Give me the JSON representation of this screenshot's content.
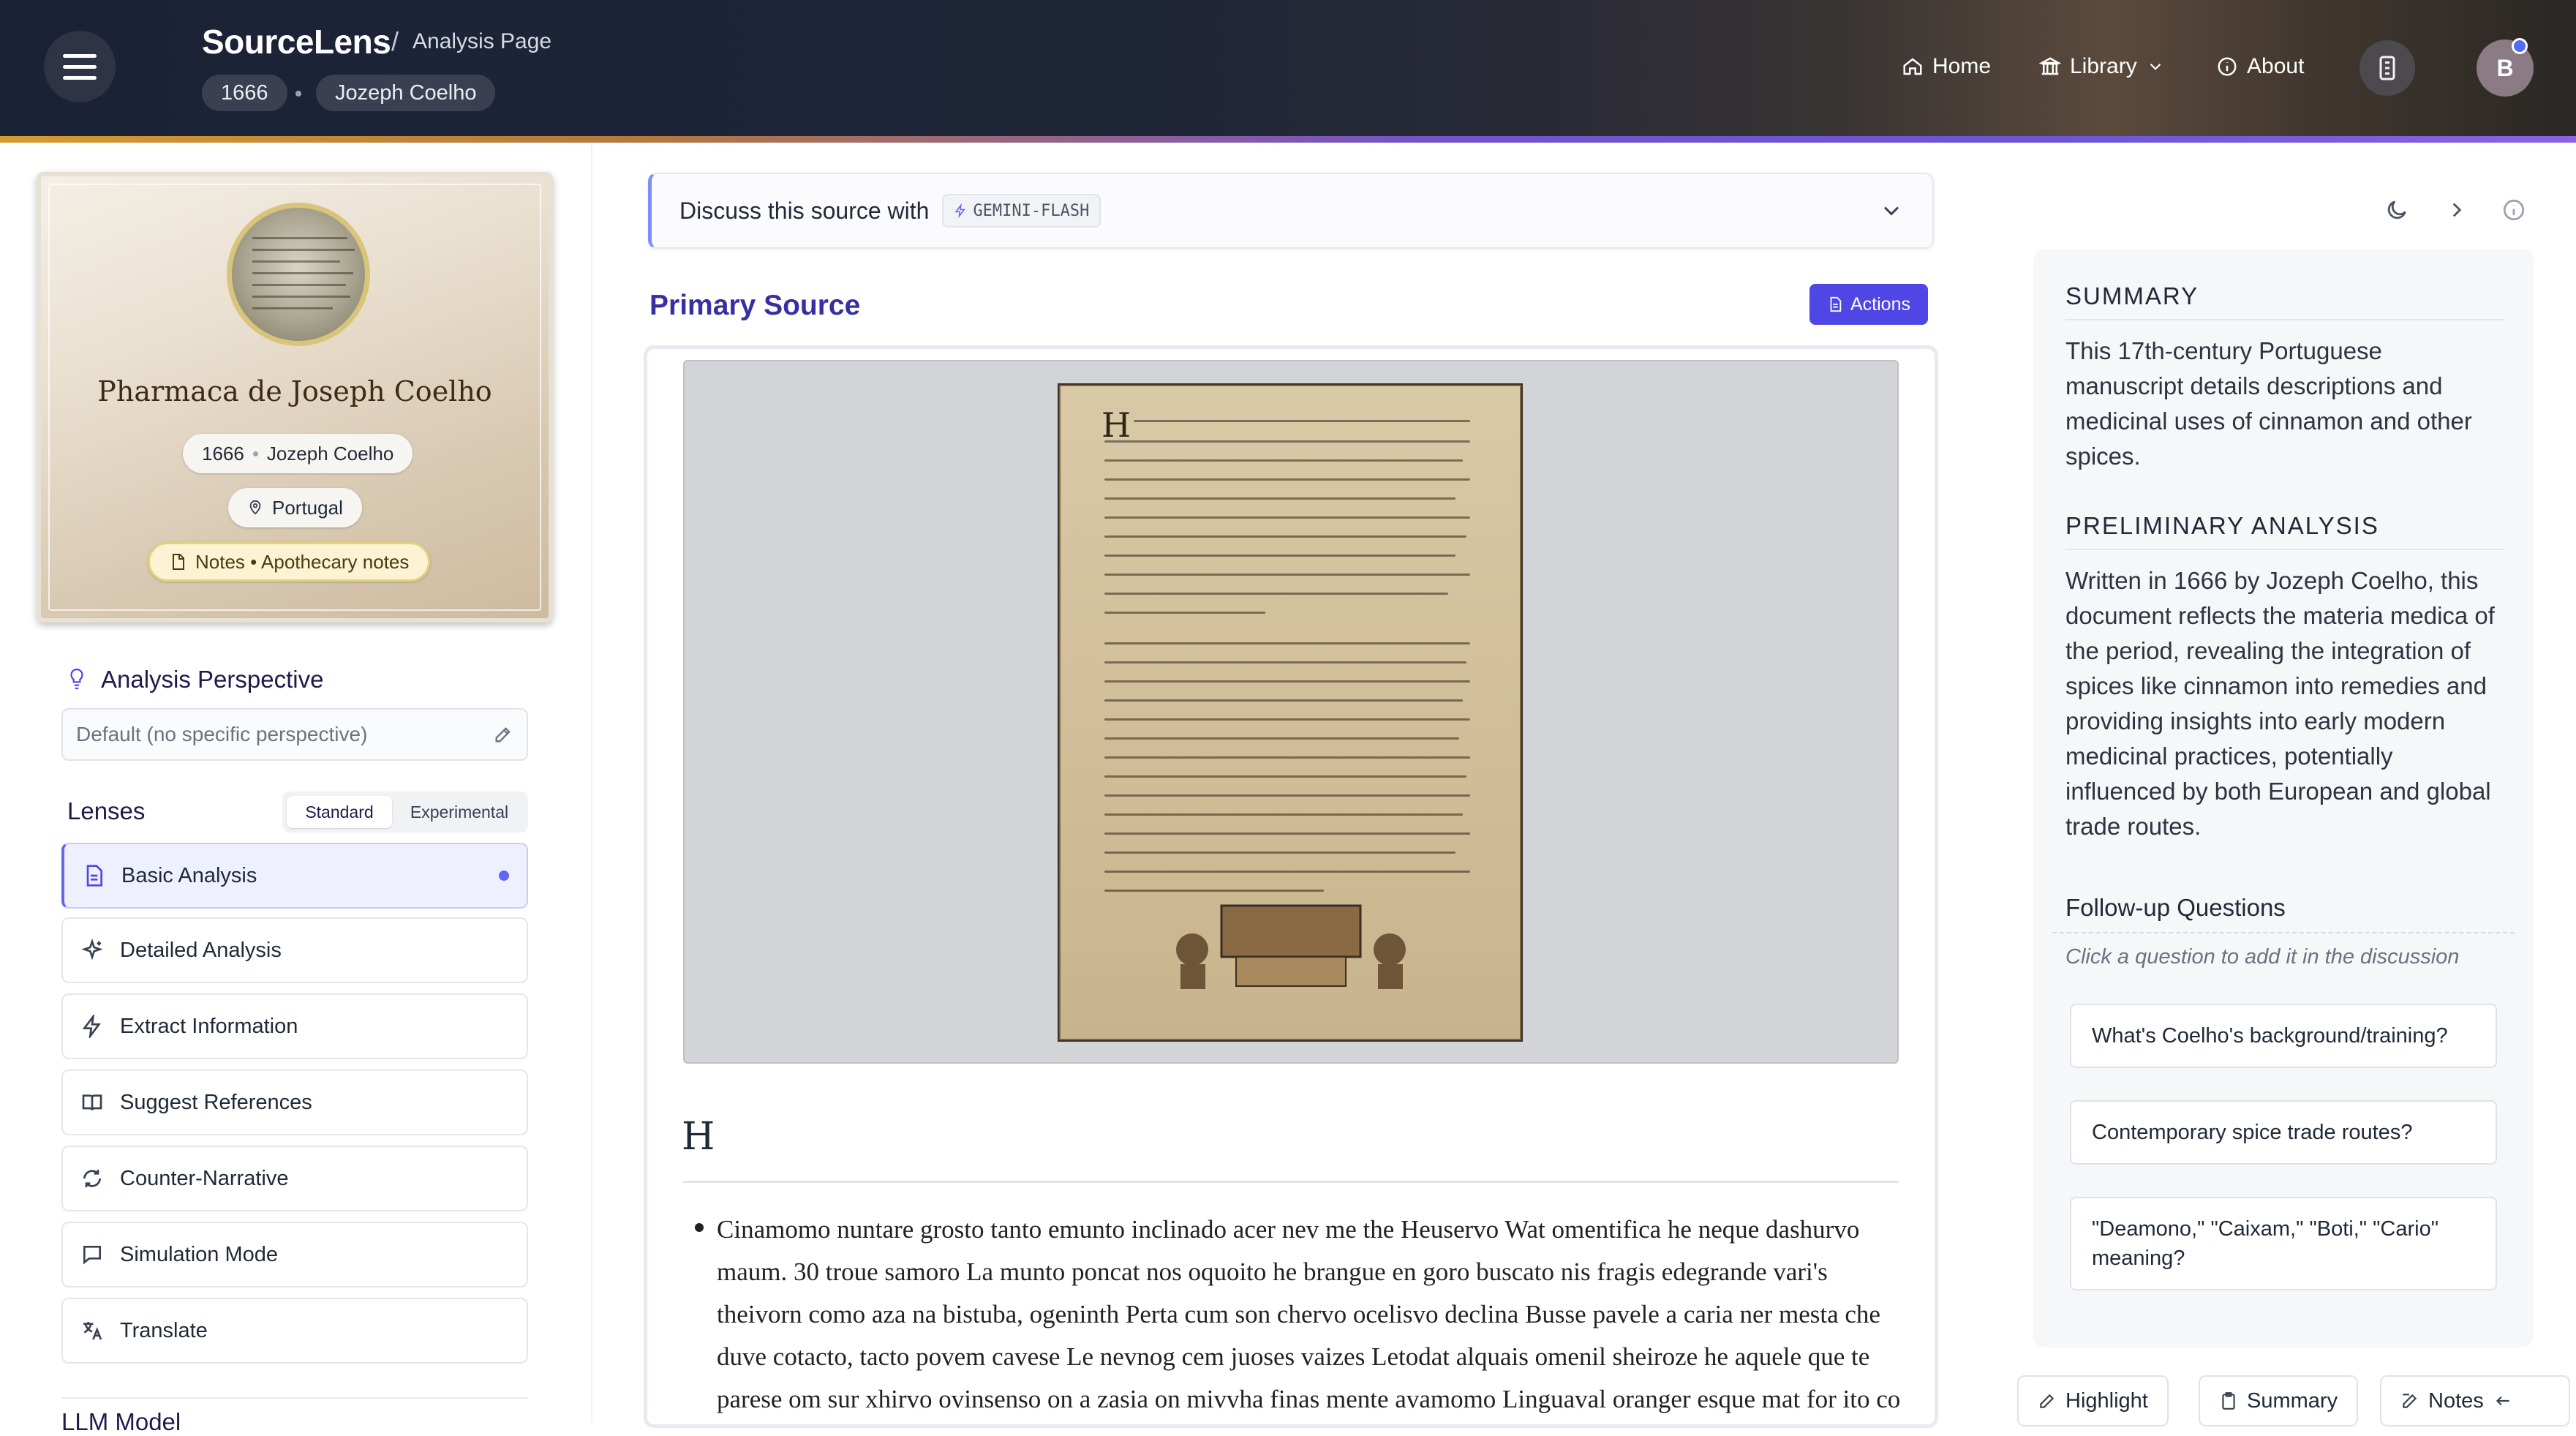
{
  "header": {
    "app_title": "SourceLens",
    "separator": "/",
    "page_label": "Analysis Page",
    "chips": [
      "1666",
      "Jozeph Coelho"
    ],
    "nav": {
      "home": "Home",
      "library": "Library",
      "about": "About"
    },
    "avatar_initial": "B"
  },
  "source_card": {
    "title": "Pharmaca de Joseph Coelho",
    "year": "1666",
    "author": "Jozeph Coelho",
    "location": "Portugal",
    "notes": "Notes • Apothecary notes"
  },
  "sidebar": {
    "perspective_title": "Analysis Perspective",
    "perspective_placeholder": "Default (no specific perspective)",
    "lenses_title": "Lenses",
    "lens_modes": [
      "Standard",
      "Experimental"
    ],
    "lenses": [
      {
        "label": "Basic Analysis",
        "icon": "document-icon",
        "active": true
      },
      {
        "label": "Detailed Analysis",
        "icon": "sparkle-icon",
        "active": false
      },
      {
        "label": "Extract Information",
        "icon": "lightning-icon",
        "active": false
      },
      {
        "label": "Suggest References",
        "icon": "book-icon",
        "active": false
      },
      {
        "label": "Counter-Narrative",
        "icon": "refresh-icon",
        "active": false
      },
      {
        "label": "Simulation Mode",
        "icon": "chat-icon",
        "active": false
      },
      {
        "label": "Translate",
        "icon": "translate-icon",
        "active": false
      }
    ],
    "llm_model_title": "LLM Model"
  },
  "main": {
    "discuss_label": "Discuss this source with",
    "model_name": "GEMINI-FLASH",
    "primary_source_title": "Primary Source",
    "actions_label": "Actions",
    "doc_heading": "H",
    "doc_paragraph": "Cinamomo nuntare grosto tanto emunto inclinado acer nev me the Heuservo Wat omentifica he neque dashurvo maum. 30 troue samoro La munto poncat nos oquoito he brangue en goro buscato nis fragis edegrande vari's theivorn como aza na bistuba, ogeninth Perta cum son chervo ocelisvo declina Busse pavele a caria ner mesta che duve cotacto, tacto povem cavese Le nevnog cem juoses vaizes Letodat alquais omenil sheiroze he aquele que te parese om sur xhirvo ovinsenso on a zasia on mivvha finas mente avamomo Linguaval oranger esque mat for ito co que nives anwro je zabor"
  },
  "right_panel": {
    "summary_title": "SUMMARY",
    "summary_text": "This 17th-century Portuguese manuscript details descriptions and medicinal uses of cinnamon and other spices.",
    "prelim_title": "PRELIMINARY ANALYSIS",
    "prelim_text": "Written in 1666 by Jozeph Coelho, this document reflects the materia medica of the period, revealing the integration of spices like cinnamon into remedies and providing insights into early modern medicinal practices, potentially influenced by both European and global trade routes.",
    "followup_title": "Follow-up Questions",
    "followup_hint": "Click a question to add it in the discussion",
    "questions": [
      "What's Coelho's background/training?",
      "Contemporary spice trade routes?",
      "\"Deamono,\" \"Caixam,\" \"Boti,\" \"Cario\" meaning?"
    ],
    "bottom_tabs": [
      "Highlight",
      "Summary",
      "Notes"
    ]
  },
  "colors": {
    "accent": "#4f46e5",
    "header_bg": "#1d2438",
    "active_lens_bg": "#eef0fe",
    "gold_band": "#d59a2f"
  }
}
